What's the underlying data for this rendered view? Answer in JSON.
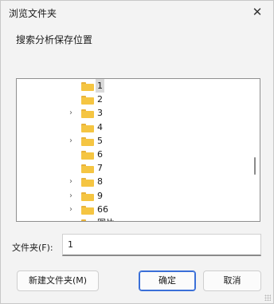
{
  "dialog": {
    "title": "浏览文件夹",
    "close_glyph": "✕",
    "instruction": "搜索分析保存位置"
  },
  "tree": {
    "items": [
      {
        "name": "1",
        "has_children": false,
        "selected": true
      },
      {
        "name": "2",
        "has_children": false,
        "selected": false
      },
      {
        "name": "3",
        "has_children": true,
        "selected": false
      },
      {
        "name": "4",
        "has_children": false,
        "selected": false
      },
      {
        "name": "5",
        "has_children": true,
        "selected": false
      },
      {
        "name": "6",
        "has_children": false,
        "selected": false
      },
      {
        "name": "7",
        "has_children": false,
        "selected": false
      },
      {
        "name": "8",
        "has_children": true,
        "selected": false
      },
      {
        "name": "9",
        "has_children": true,
        "selected": false
      },
      {
        "name": "66",
        "has_children": true,
        "selected": false
      },
      {
        "name": "图片",
        "has_children": false,
        "selected": false
      }
    ],
    "expander_glyph": "›",
    "folder_icon": "folder-icon"
  },
  "folder_field": {
    "label": "文件夹(F):",
    "value": "1"
  },
  "buttons": {
    "new_folder": "新建文件夹(M)",
    "ok": "确定",
    "cancel": "取消"
  },
  "colors": {
    "accent": "#3a6fd8",
    "folder": "#f5c542"
  }
}
